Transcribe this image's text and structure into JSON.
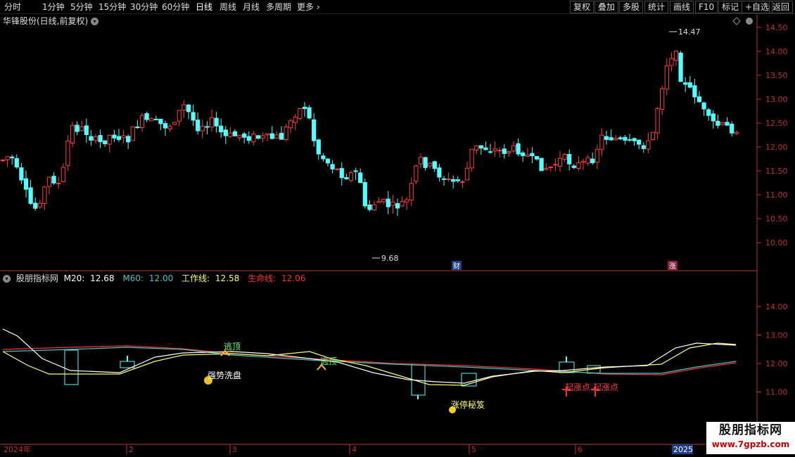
{
  "toolbar": {
    "periods": [
      "分时",
      "1分钟",
      "5分钟",
      "15分钟",
      "30分钟",
      "60分钟",
      "日线",
      "周线",
      "月线",
      "多周期",
      "更多"
    ],
    "active_period": "日线",
    "more_arrow": "›",
    "right_buttons": [
      "复权",
      "叠加",
      "多股",
      "统计",
      "画线",
      "F10",
      "标记",
      "+自选",
      "返回"
    ]
  },
  "stock": {
    "title": "华锋股份(日线,前复权)"
  },
  "main_axis": {
    "ticks": [
      "14.50",
      "14.00",
      "13.50",
      "13.00",
      "12.50",
      "12.00",
      "11.50",
      "11.00",
      "10.50",
      "10.00"
    ]
  },
  "main_chart_labels": {
    "high": "14.47",
    "low": "9.68",
    "marker_cai": "财",
    "marker_zhang": "涨"
  },
  "indicator": {
    "name": "股朋指标网",
    "m20_label": "M20:",
    "m20_value": "12.68",
    "m60_label": "M60:",
    "m60_value": "12.00",
    "work_label": "工作线:",
    "work_value": "12.58",
    "life_label": "生命线:",
    "life_value": "12.06"
  },
  "ind_axis": {
    "ticks": [
      "14.00",
      "13.00",
      "12.00",
      "11.00"
    ]
  },
  "signals": {
    "qsxp": "强势洗盘",
    "tao1": "逃顶",
    "tao2": "逃顶",
    "ztmj": "涨停秘笈",
    "qzd1": "起涨点",
    "qzd2": "起涨点"
  },
  "time_axis": {
    "labels": [
      "2024年",
      "2",
      "3",
      "4",
      "5",
      "6",
      "2025"
    ]
  },
  "watermark": {
    "name": "股朋指标网",
    "url": "www.7gpzb.com"
  },
  "colors": {
    "up": "#ff3c3c",
    "down": "#54ffff",
    "axis": "#c03030",
    "m20": "#ffffff",
    "m60": "#3fc7c7",
    "work": "#ffff66",
    "life": "#ff3030"
  }
}
